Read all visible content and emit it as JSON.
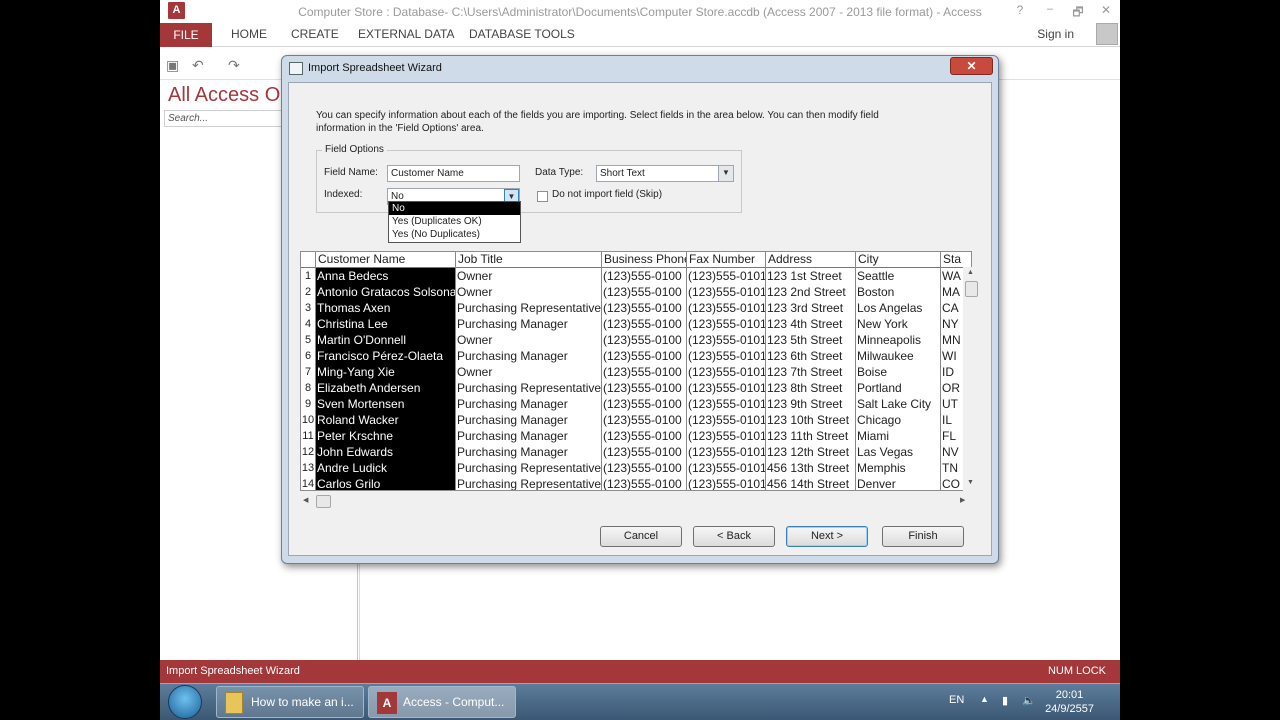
{
  "app": {
    "title": "Computer Store : Database- C:\\Users\\Administrator\\Documents\\Computer Store.accdb (Access 2007 - 2013 file format) - Access",
    "logo": "A",
    "help": "?",
    "restore": "🗗",
    "close": "✕"
  },
  "ribbon": {
    "tabs": [
      "FILE",
      "HOME",
      "CREATE",
      "EXTERNAL DATA",
      "DATABASE TOOLS"
    ],
    "sign_in": "Sign in"
  },
  "nav_pane": {
    "title": "All Access Ob",
    "search_placeholder": "Search..."
  },
  "status_bar": {
    "left": "Import Spreadsheet Wizard",
    "right": "NUM LOCK"
  },
  "dialog": {
    "title": "Import Spreadsheet Wizard",
    "close": "✕",
    "intro": "You can specify information about each of the fields you are importing. Select fields in the area below. You can then modify field information in the 'Field Options' area.",
    "field_options": {
      "legend": "Field Options",
      "field_name_label": "Field Name:",
      "field_name_value": "Customer Name",
      "data_type_label": "Data Type:",
      "data_type_value": "Short Text",
      "indexed_label": "Indexed:",
      "indexed_value": "No",
      "indexed_options": [
        "No",
        "Yes (Duplicates OK)",
        "Yes (No Duplicates)"
      ],
      "skip_label": "Do not import field (Skip)"
    },
    "grid": {
      "columns": [
        "Customer Name",
        "Job Title",
        "Business Phone",
        "Fax Number",
        "Address",
        "City",
        "Sta"
      ],
      "rows": [
        [
          "1",
          "Anna Bedecs",
          "Owner",
          "(123)555-0100",
          "(123)555-0101",
          "123 1st Street",
          "Seattle",
          "WA"
        ],
        [
          "2",
          "Antonio Gratacos Solsona",
          "Owner",
          "(123)555-0100",
          "(123)555-0101",
          "123 2nd Street",
          "Boston",
          "MA"
        ],
        [
          "3",
          "Thomas Axen",
          "Purchasing Representative",
          "(123)555-0100",
          "(123)555-0101",
          "123 3rd Street",
          "Los Angelas",
          "CA"
        ],
        [
          "4",
          "Christina Lee",
          "Purchasing Manager",
          "(123)555-0100",
          "(123)555-0101",
          "123 4th Street",
          "New York",
          "NY"
        ],
        [
          "5",
          "Martin O'Donnell",
          "Owner",
          "(123)555-0100",
          "(123)555-0101",
          "123 5th Street",
          "Minneapolis",
          "MN"
        ],
        [
          "6",
          "Francisco Pérez-Olaeta",
          "Purchasing Manager",
          "(123)555-0100",
          "(123)555-0101",
          "123 6th Street",
          "Milwaukee",
          "WI"
        ],
        [
          "7",
          "Ming-Yang Xie",
          "Owner",
          "(123)555-0100",
          "(123)555-0101",
          "123 7th Street",
          "Boise",
          "ID"
        ],
        [
          "8",
          "Elizabeth Andersen",
          "Purchasing Representative",
          "(123)555-0100",
          "(123)555-0101",
          "123 8th Street",
          "Portland",
          "OR"
        ],
        [
          "9",
          "Sven Mortensen",
          "Purchasing Manager",
          "(123)555-0100",
          "(123)555-0101",
          "123 9th Street",
          "Salt Lake City",
          "UT"
        ],
        [
          "10",
          "Roland Wacker",
          "Purchasing Manager",
          "(123)555-0100",
          "(123)555-0101",
          "123 10th Street",
          "Chicago",
          "IL"
        ],
        [
          "11",
          "Peter Krschne",
          "Purchasing Manager",
          "(123)555-0100",
          "(123)555-0101",
          "123 11th Street",
          "Miami",
          "FL"
        ],
        [
          "12",
          "John Edwards",
          "Purchasing Manager",
          "(123)555-0100",
          "(123)555-0101",
          "123 12th Street",
          "Las Vegas",
          "NV"
        ],
        [
          "13",
          "Andre Ludick",
          "Purchasing Representative",
          "(123)555-0100",
          "(123)555-0101",
          "456 13th Street",
          "Memphis",
          "TN"
        ],
        [
          "14",
          "Carlos Grilo",
          "Purchasing Representative",
          "(123)555-0100",
          "(123)555-0101",
          "456 14th Street",
          "Denver",
          "CO"
        ]
      ]
    },
    "buttons": {
      "cancel": "Cancel",
      "back": "< Back",
      "next": "Next >",
      "finish": "Finish"
    }
  },
  "taskbar": {
    "items": [
      "How to make an i...",
      "Access - Comput..."
    ],
    "lang": "EN",
    "time": "20:01",
    "date": "24/9/2557"
  },
  "colors": {
    "accent": "#a4373a",
    "selection": "#000000"
  }
}
